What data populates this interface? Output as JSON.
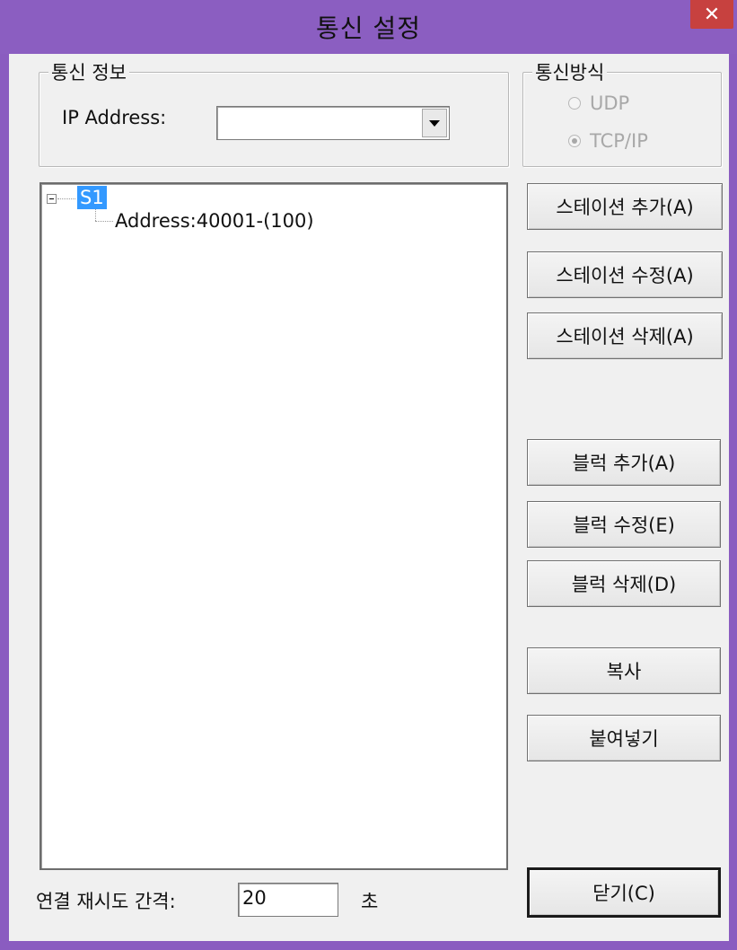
{
  "window": {
    "title": "통신 설정",
    "close_label": "✕"
  },
  "comm_info": {
    "legend": "통신 정보",
    "ip_label": "IP Address:",
    "ip_value": ""
  },
  "comm_method": {
    "legend": "통신방식",
    "options": [
      {
        "label": "UDP",
        "checked": false
      },
      {
        "label": "TCP/IP",
        "checked": true
      }
    ]
  },
  "tree": {
    "root": "S1",
    "children": [
      "Address:40001-(100)"
    ]
  },
  "buttons": {
    "add_station": "스테이션 추가(A)",
    "edit_station": "스테이션 수정(A)",
    "delete_station": "스테이션 삭제(A)",
    "add_block": "블럭 추가(A)",
    "edit_block": "블럭 수정(E)",
    "delete_block": "블럭 삭제(D)",
    "copy": "복사",
    "paste": "붙여넣기",
    "close": "닫기(C)"
  },
  "retry": {
    "label": "연결 재시도 간격:",
    "value": "20",
    "unit": "초"
  }
}
